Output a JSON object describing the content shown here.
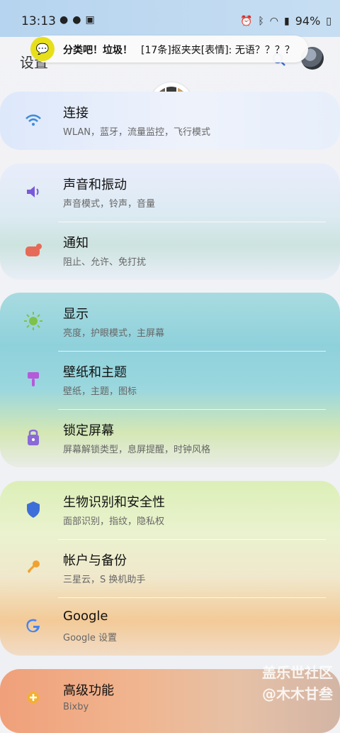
{
  "statusbar": {
    "time": "13:13",
    "battery": "94%"
  },
  "header": {
    "title": "设置"
  },
  "notification": {
    "group": "分类吧！垃圾！",
    "message": "[17条]抠夹夹[表情]: 无语？？？？"
  },
  "settings": [
    {
      "title": "连接",
      "subtitle": "WLAN，蓝牙，流量监控，飞行模式",
      "icon": "wifi-icon",
      "color": "#3f8bd9"
    },
    {
      "title": "声音和振动",
      "subtitle": "声音模式，铃声，音量",
      "icon": "speaker-icon",
      "color": "#7a5ad8"
    },
    {
      "title": "通知",
      "subtitle": "阻止、允许、免打扰",
      "icon": "notification-icon",
      "color": "#e66a57"
    },
    {
      "title": "显示",
      "subtitle": "亮度，护眼模式，主屏幕",
      "icon": "brightness-icon",
      "color": "#7ec24a"
    },
    {
      "title": "壁纸和主题",
      "subtitle": "壁纸，主题，图标",
      "icon": "brush-icon",
      "color": "#b55ad9"
    },
    {
      "title": "锁定屏幕",
      "subtitle": "屏幕解锁类型，息屏提醒，时钟风格",
      "icon": "lock-icon",
      "color": "#8a6ad6"
    },
    {
      "title": "生物识别和安全性",
      "subtitle": "面部识别，指纹，隐私权",
      "icon": "shield-icon",
      "color": "#3e6ed8"
    },
    {
      "title": "帐户与备份",
      "subtitle": "三星云，S 换机助手",
      "icon": "key-icon",
      "color": "#f0a22f"
    },
    {
      "title": "Google",
      "subtitle": "Google 设置",
      "icon": "google-icon",
      "color": "#4285f4"
    },
    {
      "title": "高级功能",
      "subtitle": "Bixby",
      "icon": "gear-plus-icon",
      "color": "#f4b128"
    }
  ],
  "watermark": {
    "line1": "盖乐世社区",
    "line2": "@木木甘叁"
  }
}
